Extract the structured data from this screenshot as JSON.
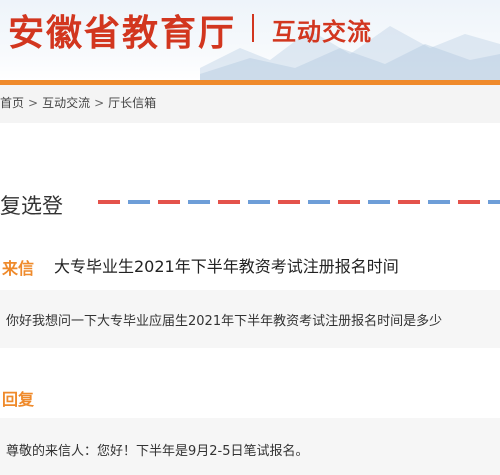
{
  "header": {
    "site_title": "安徽省教育厅",
    "section_title": "互动交流"
  },
  "breadcrumb": {
    "items": [
      "首页",
      "互动交流",
      "厅长信箱"
    ],
    "separator": ">"
  },
  "page": {
    "heading": "复选登"
  },
  "letter": {
    "label": "来信",
    "subject": "大专毕业生2021年下半年教资考试注册报名时间",
    "body": "你好我想问一下大专毕业应届生2021年下半年教资考试注册报名时间是多少"
  },
  "reply": {
    "label": "回复",
    "body": "尊敬的来信人：您好！下半年是9月2-5日笔试报名。"
  },
  "colors": {
    "brand_red": "#d2361f",
    "accent_orange": "#ef8a2b",
    "airmail_red": "#e4524b",
    "airmail_blue": "#6e9ed8"
  }
}
